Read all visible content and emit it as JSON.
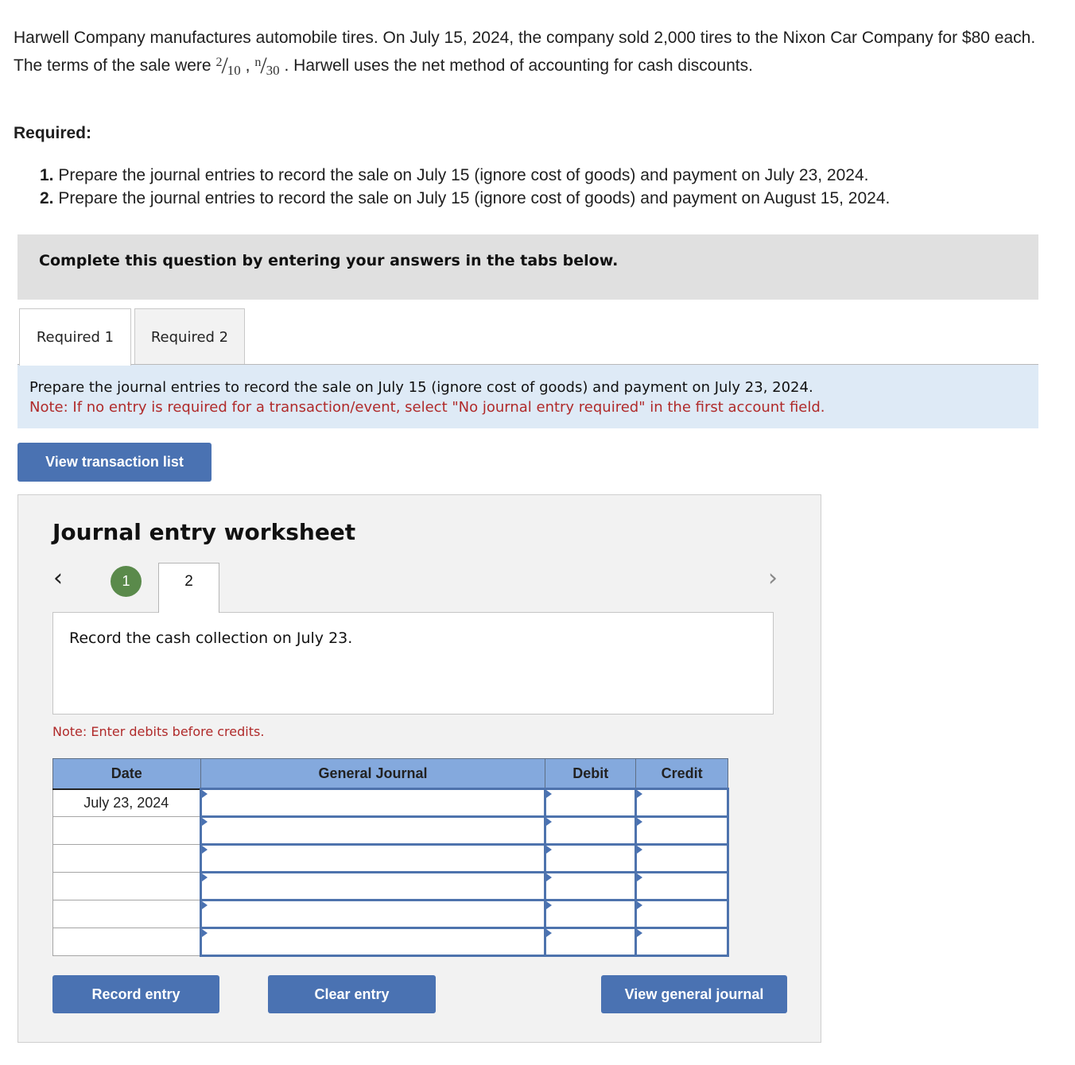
{
  "problem": {
    "intro_part1": "Harwell Company manufactures automobile tires. On July 15, 2024, the company sold 2,000 tires to the Nixon Car Company for $80 each. The terms of the sale were ",
    "terms": [
      {
        "numerator": "2",
        "denominator": "10"
      },
      {
        "numerator": "n",
        "denominator": "30"
      }
    ],
    "terms_separator": " , ",
    "intro_part2": " . Harwell uses the net method of accounting for cash discounts.",
    "required_label": "Required:",
    "requirements": [
      {
        "number": "1.",
        "text": " Prepare the journal entries to record the sale on July 15 (ignore cost of goods) and payment on July 23, 2024."
      },
      {
        "number": "2.",
        "text": " Prepare the journal entries to record the sale on July 15 (ignore cost of goods) and payment on August 15, 2024."
      }
    ]
  },
  "banner": {
    "text": "Complete this question by entering your answers in the tabs below."
  },
  "tabs": [
    {
      "label": "Required 1",
      "active": true
    },
    {
      "label": "Required 2",
      "active": false
    }
  ],
  "instructions": {
    "main": "Prepare the journal entries to record the sale on July 15 (ignore cost of goods) and payment on July 23, 2024.",
    "note": "Note: If no entry is required for a transaction/event, select \"No journal entry required\" in the first account field."
  },
  "buttons": {
    "view_transaction_list": "View transaction list",
    "record_entry": "Record entry",
    "clear_entry": "Clear entry",
    "view_general_journal": "View general journal"
  },
  "worksheet": {
    "title": "Journal entry worksheet",
    "prev_icon": "chevron-left-icon",
    "next_icon": "chevron-right-icon",
    "steps": [
      {
        "label": "1",
        "state": "completed"
      },
      {
        "label": "2",
        "state": "current"
      }
    ],
    "description": "Record the cash collection on July 23.",
    "debit_note": "Note: Enter debits before credits.",
    "table": {
      "headers": [
        "Date",
        "General Journal",
        "Debit",
        "Credit"
      ],
      "rows": [
        {
          "date": "July 23, 2024",
          "account": "",
          "debit": "",
          "credit": ""
        },
        {
          "date": "",
          "account": "",
          "debit": "",
          "credit": ""
        },
        {
          "date": "",
          "account": "",
          "debit": "",
          "credit": ""
        },
        {
          "date": "",
          "account": "",
          "debit": "",
          "credit": ""
        },
        {
          "date": "",
          "account": "",
          "debit": "",
          "credit": ""
        },
        {
          "date": "",
          "account": "",
          "debit": "",
          "credit": ""
        }
      ]
    }
  },
  "colors": {
    "button_blue": "#4a72b2",
    "header_blue": "#84a9dd",
    "note_red": "#b02a2a",
    "step_green": "#5a8a4b",
    "instructions_bg": "#deeaf6"
  }
}
